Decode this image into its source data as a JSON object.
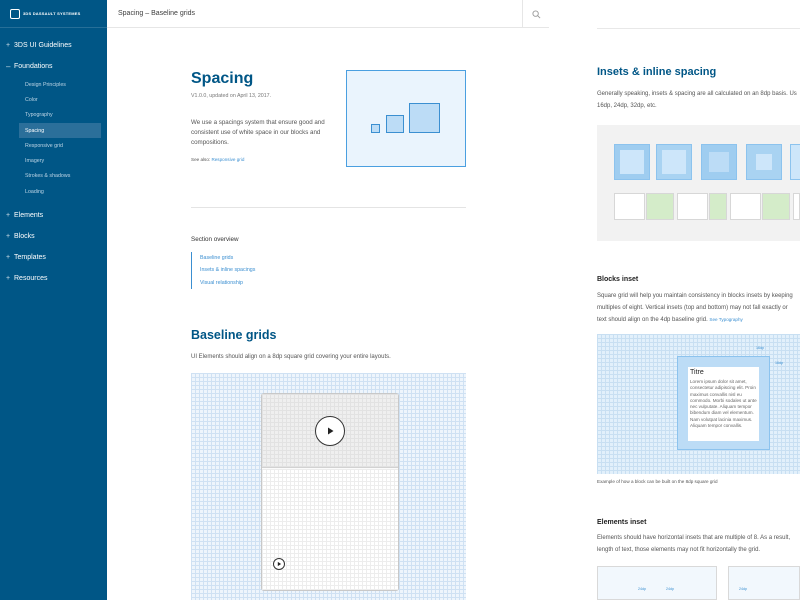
{
  "sidebar": {
    "logo": "3DS DASSAULT SYSTEMES",
    "nav": [
      {
        "label": "3DS UI Guidelines",
        "expanded": false
      },
      {
        "label": "Foundations",
        "expanded": true
      },
      {
        "label": "Elements",
        "expanded": false
      },
      {
        "label": "Blocks",
        "expanded": false
      },
      {
        "label": "Templates",
        "expanded": false
      },
      {
        "label": "Resources",
        "expanded": false
      }
    ],
    "foundations_items": [
      "Design Principles",
      "Color",
      "Typography",
      "Spacing",
      "Responsive grid",
      "Imagery",
      "Strokes & shadows",
      "Loading"
    ],
    "active_item": "Spacing"
  },
  "header": {
    "title": "Spacing – Baseline grids",
    "search_icon": "search-icon"
  },
  "page": {
    "title": "Spacing",
    "version": "V1.0.0, updated on April 13, 2017.",
    "intro": "We use a spacings system that ensure good and consistent use of white space in our blocks and compositions.",
    "see_also_label": "See also:",
    "see_also_link": "Responsive grid",
    "overview_title": "Section overview",
    "overview_items": [
      "Baseline grids",
      "Insets & inline spacings",
      "Visual relationship"
    ],
    "baseline_title": "Baseline grids",
    "baseline_text": "UI Elements should align on a 8dp square grid covering your entire layouts."
  },
  "preview": {
    "insets_title": "Insets & inline spacing",
    "insets_text_1": "Generally speaking, insets & spacing are all calculated on an 8dp basis. Us",
    "insets_text_2": "16dp, 24dp, 32dp, etc.",
    "blocks_title": "Blocks inset",
    "blocks_text_1": "Square grid will help you maintain consistency in blocks insets by keeping",
    "blocks_text_2": "multiples of eight. Vertical insets (top and bottom) may not fall exactly or",
    "blocks_text_3": "text should align on the 4dp baseline grid.",
    "blocks_see": "See Typography",
    "block_card_title": "Titre",
    "block_card_body": "Lorem ipsum dolor sit amet, consectetur adipiscing elit. Proin maximus convallis nisl eu commodo. Morbi sodales ut ante nec vulputate. Aliquam tempor bibendum diam vel elementum. Nam volutpat lacinia maximus. Aliquam tempor convallis.",
    "mini_label_16dp": "16dp",
    "caption": "Example of how a block can be built on the 8dp square grid",
    "elements_title": "Elements inset",
    "elements_text_1": "Elements should have horizontal insets that are multiple of 8. As a result,",
    "elements_text_2": "length of text, those elements may not fit horizontally the grid.",
    "mini_label_24dp": "24dp"
  },
  "colors": {
    "sidebar": "#005686",
    "accent": "#3b8fd1",
    "title": "#005686"
  }
}
